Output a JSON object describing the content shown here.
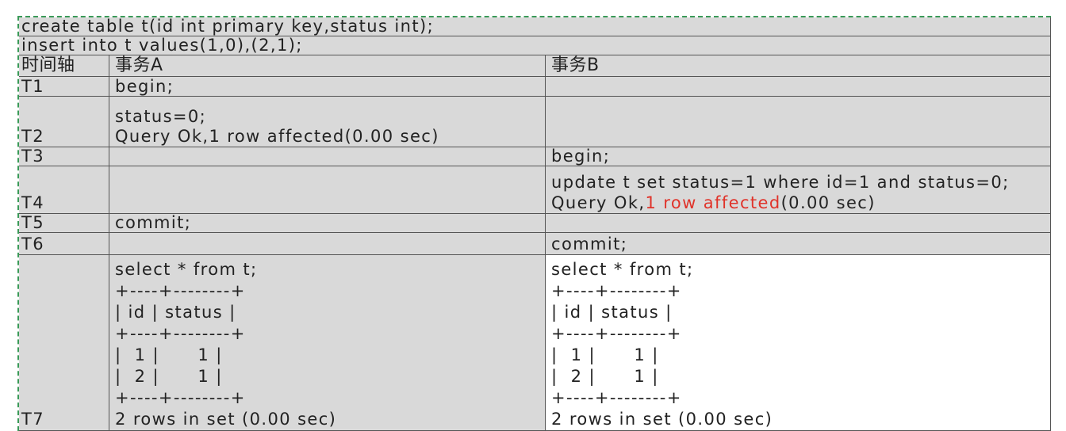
{
  "setup": {
    "create": "create table t(id int primary key,status int);",
    "insert": "insert into t values(1,0),(2,1);"
  },
  "headers": {
    "time": "时间轴",
    "a": "事务A",
    "b": "事务B"
  },
  "rows": [
    {
      "time": "T1",
      "a": [
        "begin;"
      ],
      "b": []
    },
    {
      "time": "T2",
      "a": [
        "status=0;",
        "Query Ok,1 row affected(0.00 sec)"
      ],
      "b": []
    },
    {
      "time": "T3",
      "a": [],
      "b": [
        "begin;"
      ]
    },
    {
      "time": "T4",
      "a": [],
      "b": [
        "update t set status=1 where id=1 and status=0;",
        {
          "pre": "Query Ok,",
          "highlight": "1 row affected",
          "post": "(0.00 sec)"
        }
      ]
    },
    {
      "time": "T5",
      "a": [
        "commit;"
      ],
      "b": []
    },
    {
      "time": "T6",
      "a": [],
      "b": [
        "commit;"
      ]
    },
    {
      "time": "T7",
      "a": [
        "select * from t;",
        "+----+--------+",
        "| id | status |",
        "+----+--------+",
        "|  1 |      1 |",
        "|  2 |      1 |",
        "+----+--------+",
        "2 rows in set (0.00 sec)"
      ],
      "b": [
        "select * from t;",
        "+----+--------+",
        "| id | status |",
        "+----+--------+",
        "|  1 |      1 |",
        "|  2 |      1 |",
        "+----+--------+",
        "2 rows in set (0.00 sec)"
      ]
    }
  ],
  "colors": {
    "grid": "#555555",
    "cell": "#d9d9d9",
    "cell_light": "#ffffff",
    "marquee": "#3a9a58",
    "highlight": "#e0332a"
  }
}
